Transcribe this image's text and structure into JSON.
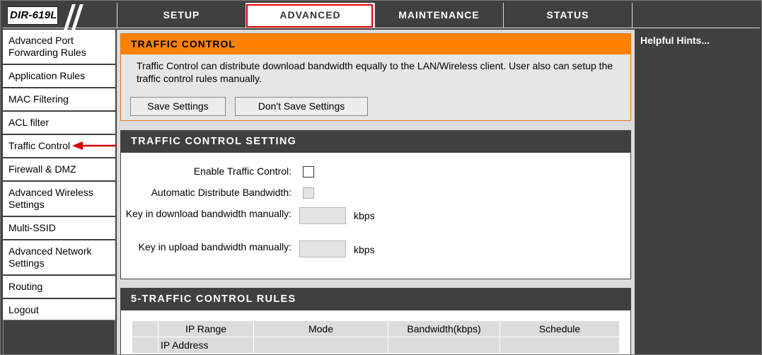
{
  "brand": {
    "model": "DIR-619L"
  },
  "tabs": [
    {
      "label": "SETUP"
    },
    {
      "label": "ADVANCED"
    },
    {
      "label": "MAINTENANCE"
    },
    {
      "label": "STATUS"
    }
  ],
  "sidebar": {
    "items": [
      {
        "label": "Advanced Port Forwarding Rules"
      },
      {
        "label": "Application Rules"
      },
      {
        "label": "MAC Filtering"
      },
      {
        "label": "ACL filter"
      },
      {
        "label": "Traffic Control"
      },
      {
        "label": "Firewall & DMZ"
      },
      {
        "label": "Advanced Wireless Settings"
      },
      {
        "label": "Multi-SSID"
      },
      {
        "label": "Advanced Network Settings"
      },
      {
        "label": "Routing"
      },
      {
        "label": "Logout"
      }
    ]
  },
  "traffic_control": {
    "title": "TRAFFIC CONTROL",
    "description": "Traffic Control can distribute download bandwidth equally to the LAN/Wireless client. User also can setup the traffic control rules manually.",
    "save_label": "Save Settings",
    "dont_save_label": "Don't Save Settings"
  },
  "settings": {
    "title": "TRAFFIC CONTROL SETTING",
    "enable_label": "Enable Traffic Control:",
    "auto_label": "Automatic Distribute Bandwidth:",
    "download_label": "Key in download bandwidth manually:",
    "upload_label": "Key in upload bandwidth manually:",
    "download_value": "",
    "upload_value": "",
    "unit": "kbps"
  },
  "rules": {
    "title": "5-TRAFFIC CONTROL RULES",
    "columns": [
      "IP Range",
      "Mode",
      "Bandwidth(kbps)",
      "Schedule"
    ],
    "row_label": "IP Address"
  },
  "hints": {
    "title": "Helpful Hints..."
  },
  "colors": {
    "accent": "#ff8100",
    "dark": "#404040",
    "highlight": "#dd0000"
  }
}
